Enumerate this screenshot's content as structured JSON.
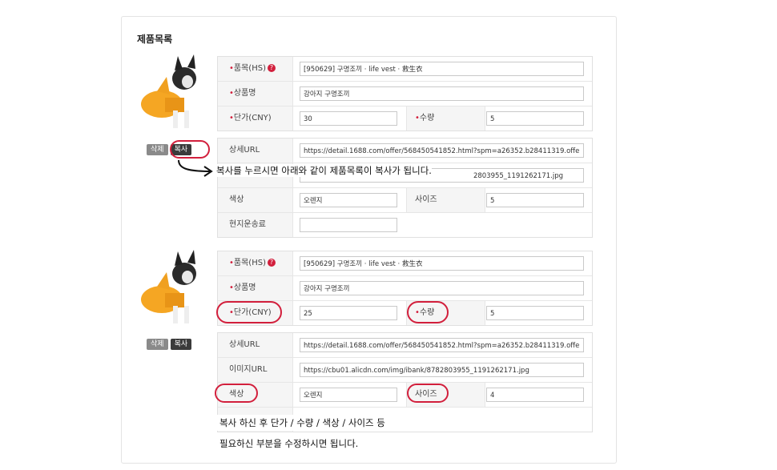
{
  "section_title": "제품목록",
  "buttons": {
    "delete": "삭제",
    "copy": "복사"
  },
  "item1": {
    "hs_label": "품목(HS)",
    "hs_value": "[950629] 구명조끼 · life vest · 救生衣",
    "name_label": "상품명",
    "name_value": "강아지 구명조끼",
    "price_label": "단가(CNY)",
    "price_value": "30",
    "qty_label": "수량",
    "qty_value": "5",
    "url_label": "상세URL",
    "url_value": "https://detail.1688.com/offer/568450541852.html?spm=a26352.b28411319.offe",
    "image_value_partial": "2803955_1191262171.jpg",
    "color_label": "색상",
    "color_value": "오렌지",
    "size_label": "사이즈",
    "size_value": "5",
    "shipping_label": "현지운송료",
    "shipping_value": ""
  },
  "item2": {
    "hs_label": "품목(HS)",
    "hs_value": "[950629] 구명조끼 · life vest · 救生衣",
    "name_label": "상품명",
    "name_value": "강아지 구명조끼",
    "price_label": "단가(CNY)",
    "price_value": "25",
    "qty_label": "수량",
    "qty_value": "5",
    "url_label": "상세URL",
    "url_value": "https://detail.1688.com/offer/568450541852.html?spm=a26352.b28411319.offe",
    "image_label": "이미지URL",
    "image_value": "https://cbu01.alicdn.com/img/ibank/8782803955_1191262171.jpg",
    "color_label": "색상",
    "color_value": "오렌지",
    "size_label": "사이즈",
    "size_value": "4"
  },
  "annotations": {
    "copy_note": "복사를 누르시면 아래와 같이 제품목록이 복사가 됩니다.",
    "edit_note_1": "복사 하신 후 단가 / 수량 / 색상 / 사이즈 등",
    "edit_note_2": "필요하신 부분을 수정하시면 됩니다."
  },
  "colors": {
    "accent": "#d21f3c",
    "vest": "#f5a623"
  }
}
